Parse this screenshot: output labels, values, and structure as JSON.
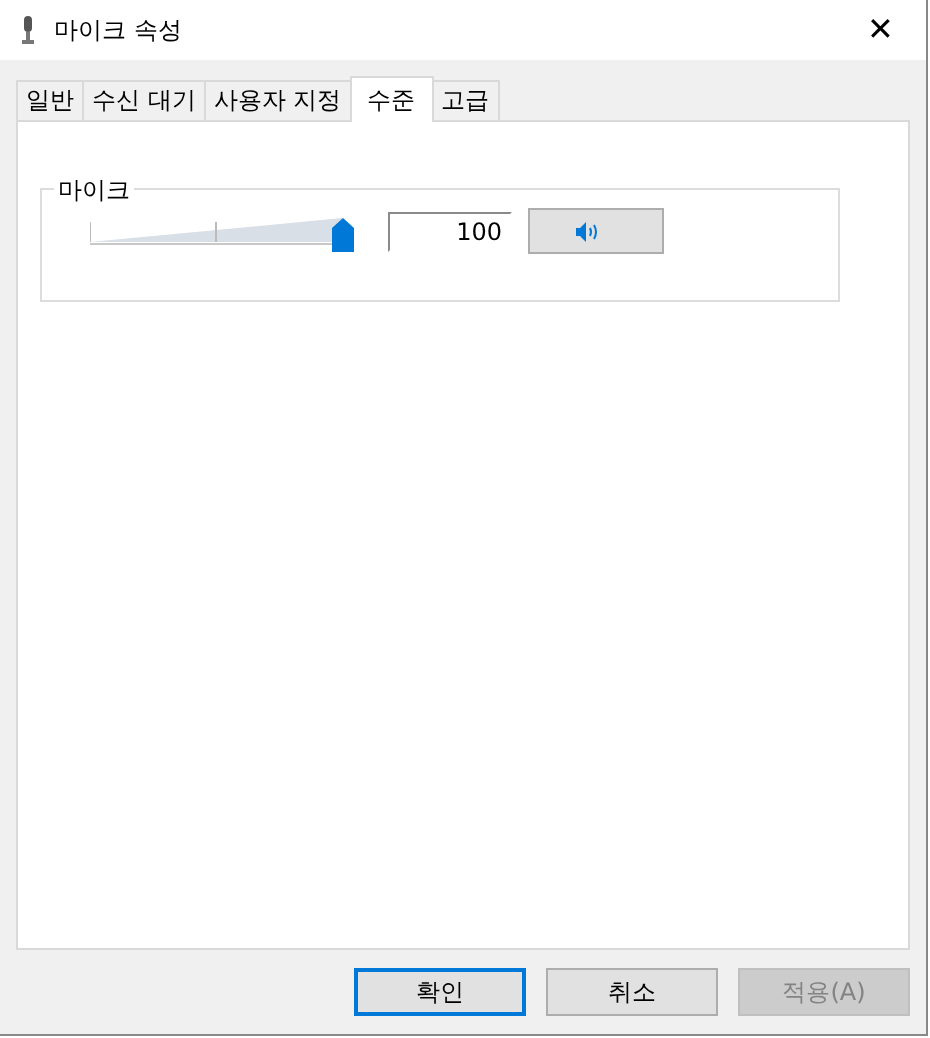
{
  "window": {
    "title": "마이크 속성",
    "close": "✕"
  },
  "tabs": [
    {
      "label": "일반",
      "selected": false
    },
    {
      "label": "수신 대기",
      "selected": false
    },
    {
      "label": "사용자 지정",
      "selected": false
    },
    {
      "label": "수준",
      "selected": true
    },
    {
      "label": "고급",
      "selected": false
    }
  ],
  "group": {
    "label": "마이크",
    "level": 1,
    "value": "100",
    "muted": false
  },
  "buttons": [
    {
      "label": "확인",
      "kind": "default",
      "disabled": false
    },
    {
      "label": "취소",
      "kind": "normal",
      "disabled": false
    },
    {
      "label": "적용(A)",
      "kind": "normal",
      "disabled": true
    }
  ]
}
